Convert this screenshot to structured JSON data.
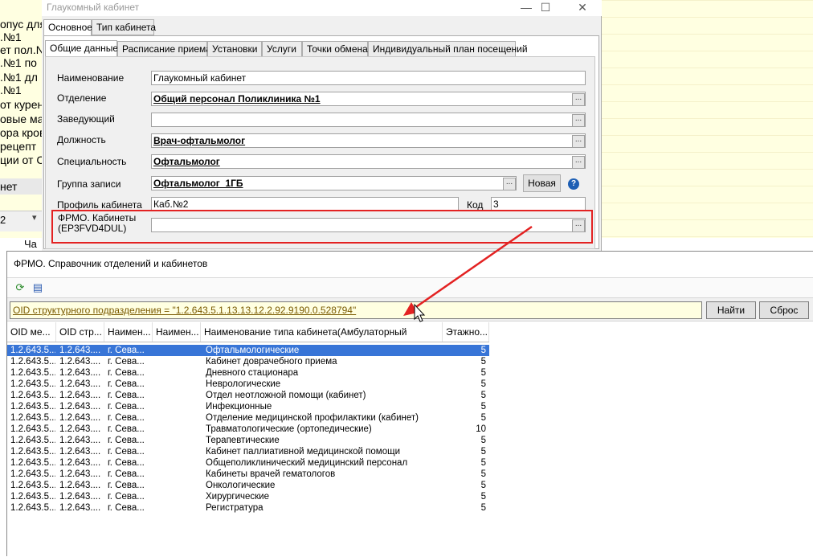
{
  "background": {
    "left_items": [
      "опус для",
      ".№1",
      "ет пол.N",
      ".№1 по",
      ".№1 дл",
      ".№1",
      "от курен",
      "овые ма",
      "ора кров",
      "рецепт",
      "ции от С"
    ],
    "selected_item": "нет",
    "dropdown_value": "2",
    "chas_label": "Ча"
  },
  "dialog": {
    "title": "Глаукомный кабинет",
    "top_tabs": [
      "Основное",
      "Тип кабинета"
    ],
    "sub_tabs": [
      "Общие данные",
      "Расписание приема",
      "Установки",
      "Услуги",
      "Точки обмена",
      "Индивидуальный план посещений"
    ],
    "fields": {
      "name_label": "Наименование",
      "name_value": "Глаукомный кабинет",
      "dept_label": "Отделение",
      "dept_value": "Общий персонал Поликлиника №1",
      "head_label": "Заведующий",
      "head_value": "",
      "position_label": "Должность",
      "position_value": "Врач-офтальмолог",
      "specialty_label": "Специальность",
      "specialty_value": "Офтальмолог",
      "group_label": "Группа записи",
      "group_value": "Офтальмолог_1ГБ",
      "new_button": "Новая",
      "profile_label": "Профиль кабинета",
      "profile_value": "Каб.№2",
      "code_label": "Код",
      "code_value": "3",
      "frmo_label_line1": "ФРМО. Кабинеты",
      "frmo_label_line2": "(EP3FVD4DUL)",
      "frmo_value": ""
    },
    "dots_label": "..."
  },
  "lookup": {
    "title": "ФРМО. Справочник отделений и кабинетов",
    "filter_text": "OID структурного подразделения = \"1.2.643.5.1.13.13.12.2.92.9190.0.528794\"",
    "find_button": "Найти",
    "reset_button": "Сброс",
    "columns": [
      "OID ме...",
      "OID стр...",
      "Наимен...",
      "Наимен...",
      "Наименование типа кабинета(Амбулаторный",
      "Этажно..."
    ],
    "rows": [
      {
        "oid1": "1.2.643.5...",
        "oid2": "1.2.643....",
        "city": "г. Сева...",
        "name2": "",
        "type": "Офтальмологические",
        "floor": "5"
      },
      {
        "oid1": "1.2.643.5...",
        "oid2": "1.2.643....",
        "city": "г. Сева...",
        "name2": "",
        "type": "Кабинет доврачебного приема",
        "floor": "5"
      },
      {
        "oid1": "1.2.643.5...",
        "oid2": "1.2.643....",
        "city": "г. Сева...",
        "name2": "",
        "type": "Дневного стационара",
        "floor": "5"
      },
      {
        "oid1": "1.2.643.5...",
        "oid2": "1.2.643....",
        "city": "г. Сева...",
        "name2": "",
        "type": "Неврологические",
        "floor": "5"
      },
      {
        "oid1": "1.2.643.5...",
        "oid2": "1.2.643....",
        "city": "г. Сева...",
        "name2": "",
        "type": "Отдел неотложной помощи (кабинет)",
        "floor": "5"
      },
      {
        "oid1": "1.2.643.5...",
        "oid2": "1.2.643....",
        "city": "г. Сева...",
        "name2": "",
        "type": "Инфекционные",
        "floor": "5"
      },
      {
        "oid1": "1.2.643.5...",
        "oid2": "1.2.643....",
        "city": "г. Сева...",
        "name2": "",
        "type": "Отделение медицинской профилактики (кабинет)",
        "floor": "5"
      },
      {
        "oid1": "1.2.643.5...",
        "oid2": "1.2.643....",
        "city": "г. Сева...",
        "name2": "",
        "type": "Травматологические (ортопедические)",
        "floor": "10"
      },
      {
        "oid1": "1.2.643.5...",
        "oid2": "1.2.643....",
        "city": "г. Сева...",
        "name2": "",
        "type": "Терапевтические",
        "floor": "5"
      },
      {
        "oid1": "1.2.643.5...",
        "oid2": "1.2.643....",
        "city": "г. Сева...",
        "name2": "",
        "type": "Кабинет паллиативной медицинской помощи",
        "floor": "5"
      },
      {
        "oid1": "1.2.643.5...",
        "oid2": "1.2.643....",
        "city": "г. Сева...",
        "name2": "",
        "type": "Общеполиклинический медицинский персонал",
        "floor": "5"
      },
      {
        "oid1": "1.2.643.5...",
        "oid2": "1.2.643....",
        "city": "г. Сева...",
        "name2": "",
        "type": "Кабинеты врачей гематологов",
        "floor": "5"
      },
      {
        "oid1": "1.2.643.5...",
        "oid2": "1.2.643....",
        "city": "г. Сева...",
        "name2": "",
        "type": "Онкологические",
        "floor": "5"
      },
      {
        "oid1": "1.2.643.5...",
        "oid2": "1.2.643....",
        "city": "г. Сева...",
        "name2": "",
        "type": "Хирургические",
        "floor": "5"
      },
      {
        "oid1": "1.2.643.5...",
        "oid2": "1.2.643....",
        "city": "г. Сева...",
        "name2": "",
        "type": "Регистратура",
        "floor": "5"
      }
    ],
    "selected_row": 0
  },
  "colors": {
    "highlight_red": "#e32222",
    "selection_blue": "#3875d7",
    "tooltip_yellow": "#ffffe1"
  },
  "icons": [
    "refresh-icon",
    "export-icon",
    "help-icon",
    "minimize-icon",
    "maximize-icon",
    "close-icon",
    "mouse-cursor-icon"
  ]
}
